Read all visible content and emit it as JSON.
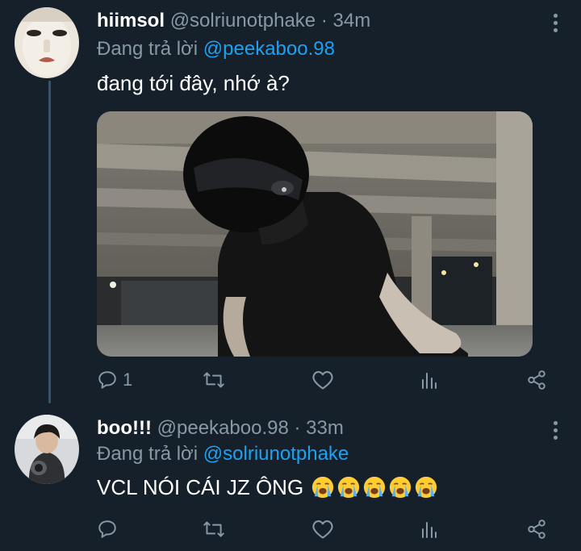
{
  "tweets": [
    {
      "name": "hiimsol",
      "handle": "@solriunotphake",
      "sep": "·",
      "time": "34m",
      "reply_prefix": "Đang trả lời",
      "reply_to": "@peekaboo.98",
      "text": "đang tới đây, nhớ à?",
      "reply_count": "1",
      "retweet_count": "",
      "like_count": ""
    },
    {
      "name": "boo!!!",
      "handle": "@peekaboo.98",
      "sep": "·",
      "time": "33m",
      "reply_prefix": "Đang trả lời",
      "reply_to": "@solriunotphake",
      "text": "VCL NÓI CÁI JZ ÔNG",
      "emoji_count": 5,
      "emoji_name": "loudly-crying-face"
    }
  ],
  "colors": {
    "background": "#15202b",
    "secondary_text": "#8899a6",
    "link": "#1da1f2",
    "thread_line": "#3d5466"
  }
}
